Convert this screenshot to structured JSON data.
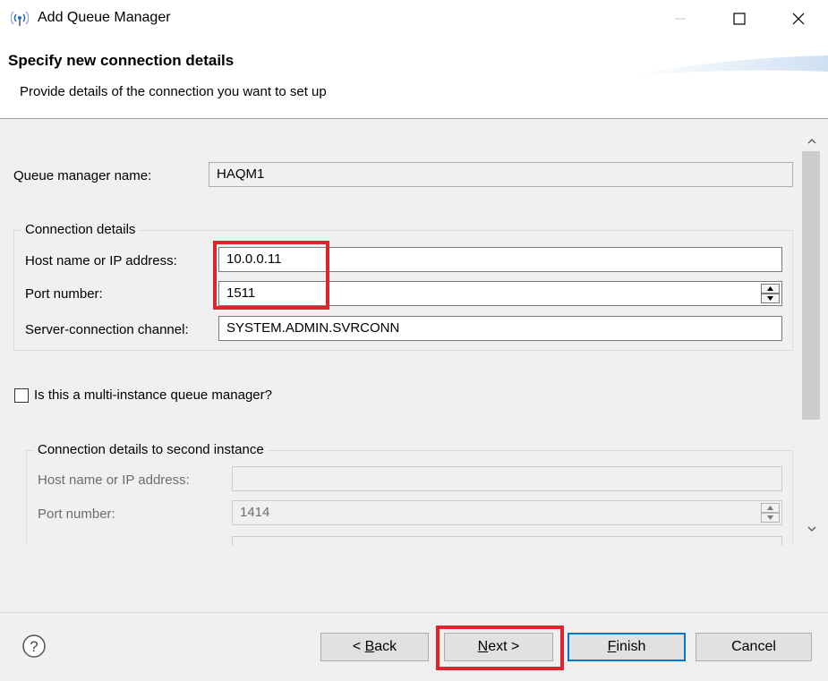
{
  "window": {
    "title": "Add Queue Manager",
    "minimize_icon": "minimize-icon",
    "maximize_icon": "maximize-icon",
    "close_icon": "close-icon",
    "app_icon": "queue-manager-antenna-icon"
  },
  "header": {
    "title": "Specify new connection details",
    "description": "Provide details of the connection you want to set up"
  },
  "form": {
    "queue_manager_name_label": "Queue manager name:",
    "queue_manager_name_value": "HAQM1",
    "connection_group_title": "Connection details",
    "host_label": "Host name or IP address:",
    "host_value": "10.0.0.11",
    "port_label": "Port number:",
    "port_value": "1511",
    "channel_label": "Server-connection channel:",
    "channel_value": "SYSTEM.ADMIN.SVRCONN",
    "multi_instance_label": "Is this a multi-instance queue manager?",
    "multi_instance_checked": false,
    "second_group_title": "Connection details to second instance",
    "second_host_label": "Host name or IP address:",
    "second_host_value": "",
    "second_port_label": "Port number:",
    "second_port_value": "1414"
  },
  "footer": {
    "help_icon": "help-icon",
    "back_label_prefix": "< ",
    "back_label_mnemonic": "B",
    "back_label_rest": "ack",
    "next_label_mnemonic": "N",
    "next_label_rest": "ext >",
    "finish_label_mnemonic": "F",
    "finish_label_rest": "inish",
    "cancel_label": "Cancel"
  },
  "colors": {
    "highlight": "#e0242b",
    "default_button_border": "#0078d7"
  }
}
